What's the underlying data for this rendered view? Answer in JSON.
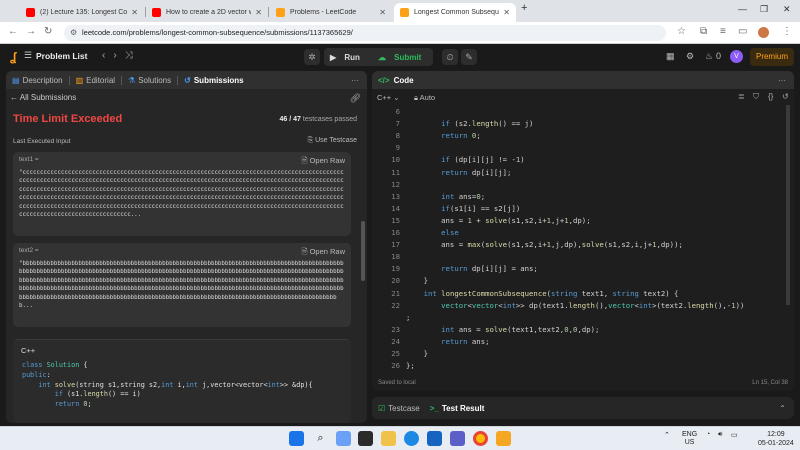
{
  "browser": {
    "tabs": [
      {
        "title": "(2) Lecture 135: Longest Comm",
        "favicon_color": "#ff0000"
      },
      {
        "title": "How to create a 2D vector with",
        "favicon_color": "#ff0000"
      },
      {
        "title": "Problems - LeetCode",
        "favicon_color": "#ffa116"
      },
      {
        "title": "Longest Common Subsequence",
        "favicon_color": "#ffa116"
      }
    ],
    "new_tab": "+",
    "url": "leetcode.com/problems/longest-common-subsequence/submissions/1137365629/"
  },
  "lc_nav": {
    "problem_list": "Problem List",
    "run": "Run",
    "submit": "Submit",
    "fire_count": "0",
    "avatar": "V",
    "premium": "Premium"
  },
  "left": {
    "tabs": [
      {
        "label": "Description",
        "icon": "doc-icon"
      },
      {
        "label": "Editorial",
        "icon": "book-icon"
      },
      {
        "label": "Solutions",
        "icon": "flask-icon"
      },
      {
        "label": "Submissions",
        "icon": "history-icon"
      }
    ],
    "all_submissions": "All Submissions",
    "status": "Time Limit Exceeded",
    "passed_count": "46 / 47",
    "passed_label": "testcases passed",
    "last_input_label": "Last Executed Input",
    "use_testcase": "Use Testcase",
    "inputs": [
      {
        "label": "text1 =",
        "open_raw": "Open Raw",
        "value": "\"cccccccccccccccccccccccccccccccccccccccccccccccccccccccccccccccccccccccccccccccccccccccccccccccccccccccccccccccccccccccccccccccccccccccccccccccccccccccccccccccccccccccccccccccccccccccccccccccccccccccccccccccccccccccccccccccccccccccccccccccccccccccccccccccccccccccccccccccccccccccccccccccccccccccccccccccccccccccccccccccccccccccccccccccccccccccccccccccccccccccccccccccccccccccccccccccccccccccccccccccccccccccccccccccccccccccccccccccccccccccccccccccccccccccccccccccccccccccccccccccccccccccccccccccc..."
      },
      {
        "label": "text2 =",
        "open_raw": "Open Raw",
        "value": "\"bbbbbbbbbbbbbbbbbbbbbbbbbbbbbbbbbbbbbbbbbbbbbbbbbbbbbbbbbbbbbbbbbbbbbbbbbbbbbbbbbbbbbbbbbbbbbbbbbbbbbbbbbbbbbbbbbbbbbbbbbbbbbbbbbbbbbbbbbbbbbbbbbbbbbbbbbbbbbbbbbbbbbbbbbbbbbbbbbbbbbbbbbbbbbbbbbbbbbbbbbbbbbbbbbbbbbbbbbbbbbbbbbbbbbbbbbbbbbbbbbbbbbbbbbbbbbbbbbbbbbbbbbbbbbbbbbbbbbbbbbbbbbbbbbbbbbbbbbbbbbbbbbbbbbbbbbbbbbbbbbbbbbbbbbbbbbbbbbbbbbbbbbbbbbbbbbbbbbbbbbbbbbbbbbbbbbbbbbbbbbbbbbbbbbbbbbbbbbbbbbbbbbbbbbbbbbbbbbbbbbbbbbbbbbbbbbbbbbbbbbbbbbbbbbbbbbbbbbbbbbbb..."
      }
    ],
    "code_lang": "C++",
    "code_lines": [
      "class Solution {",
      "public:",
      "    int solve(string s1,string s2,int i,int j,vector<vector<int>> &dp){",
      "        if (s1.length() == i)",
      "        return 0;"
    ]
  },
  "right": {
    "title": "Code",
    "lang": "C++",
    "auto": "Auto",
    "lines": [
      {
        "n": "6",
        "t": ""
      },
      {
        "n": "7",
        "t": "        if (s2.length() == j)"
      },
      {
        "n": "8",
        "t": "        return 0;"
      },
      {
        "n": "9",
        "t": ""
      },
      {
        "n": "10",
        "t": "        if (dp[i][j] != -1)"
      },
      {
        "n": "11",
        "t": "        return dp[i][j];"
      },
      {
        "n": "12",
        "t": ""
      },
      {
        "n": "13",
        "t": "        int ans=0;"
      },
      {
        "n": "14",
        "t": "        if(s1[i] == s2[j])"
      },
      {
        "n": "15",
        "t": "        ans = 1 + solve(s1,s2,i+1,j+1,dp);"
      },
      {
        "n": "16",
        "t": "        else"
      },
      {
        "n": "17",
        "t": "        ans = max(solve(s1,s2,i+1,j,dp),solve(s1,s2,i,j+1,dp));"
      },
      {
        "n": "18",
        "t": ""
      },
      {
        "n": "19",
        "t": "        return dp[i][j] = ans;"
      },
      {
        "n": "20",
        "t": "    }"
      },
      {
        "n": "21",
        "t": "    int longestCommonSubsequence(string text1, string text2) {"
      },
      {
        "n": "22",
        "t": "        vector<vector<int>> dp(text1.length(),vector<int>(text2.length(),-1))"
      },
      {
        "n": "",
        "t": ";"
      },
      {
        "n": "23",
        "t": "        int ans = solve(text1,text2,0,0,dp);"
      },
      {
        "n": "24",
        "t": "        return ans;"
      },
      {
        "n": "25",
        "t": "    }"
      },
      {
        "n": "26",
        "t": "};"
      }
    ],
    "saved": "Saved to local",
    "cursor": "Ln 15, Col 38"
  },
  "console": {
    "testcase": "Testcase",
    "test_result": "Test Result"
  },
  "taskbar": {
    "lang": "ENG",
    "region": "US",
    "time": "12:09",
    "date": "05-01-2024"
  }
}
